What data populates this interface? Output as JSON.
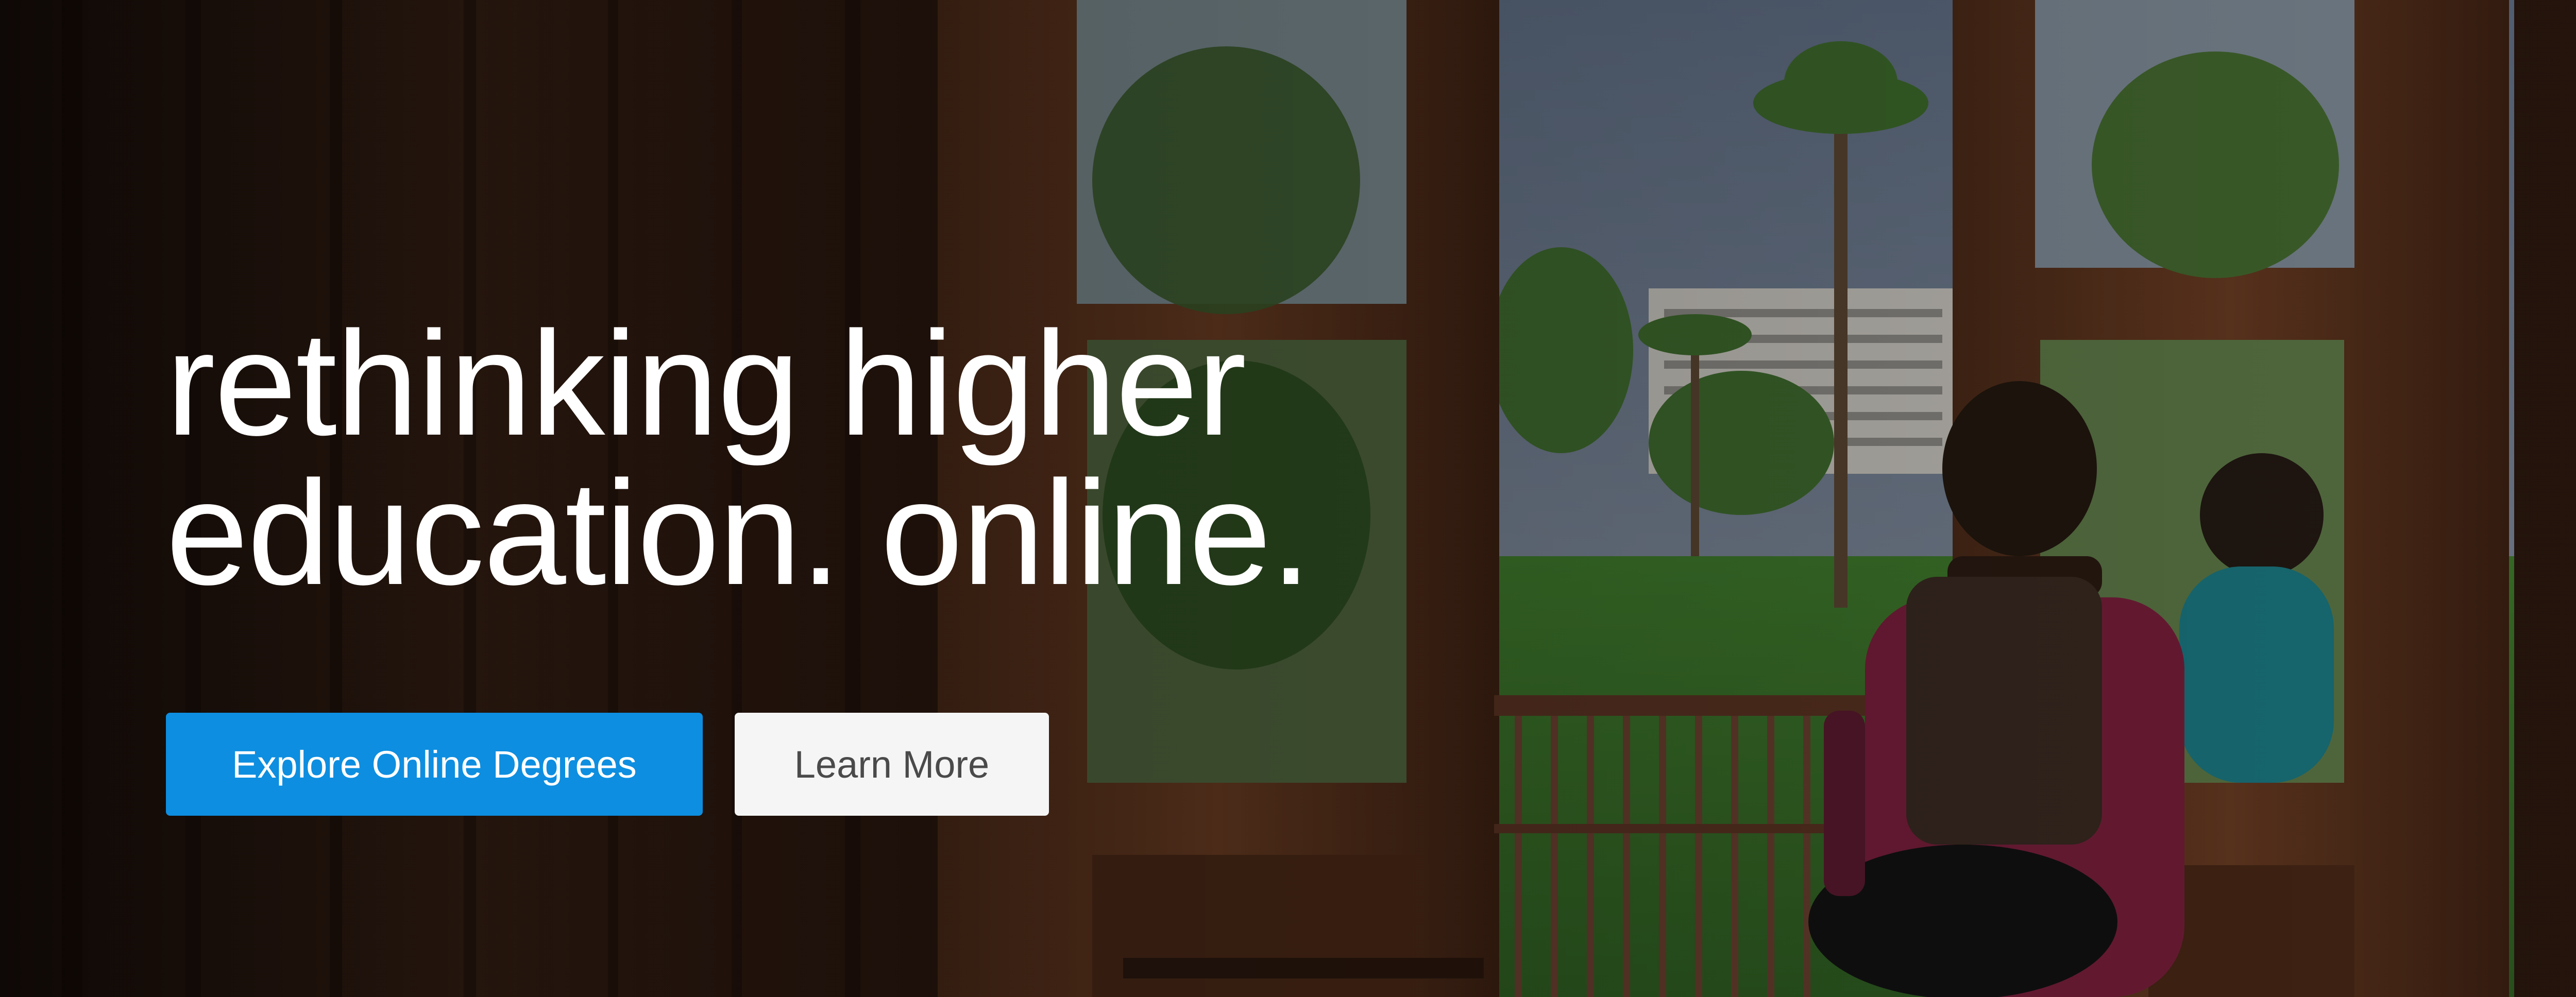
{
  "hero": {
    "headline_line1": "rethinking higher",
    "headline_line2": "education. online.",
    "buttons": {
      "primary_label": "Explore Online Degrees",
      "secondary_label": "Learn More"
    },
    "background_photo": {
      "icons": [
        "door-frame",
        "palm-tree",
        "campus-building",
        "balcony-railing",
        "person-silhouette"
      ]
    }
  },
  "colors": {
    "primary_button": "#0d8ee0",
    "secondary_button": "#f5f5f5",
    "headline_text": "#ffffff",
    "secondary_button_text": "#4a4a4a"
  }
}
